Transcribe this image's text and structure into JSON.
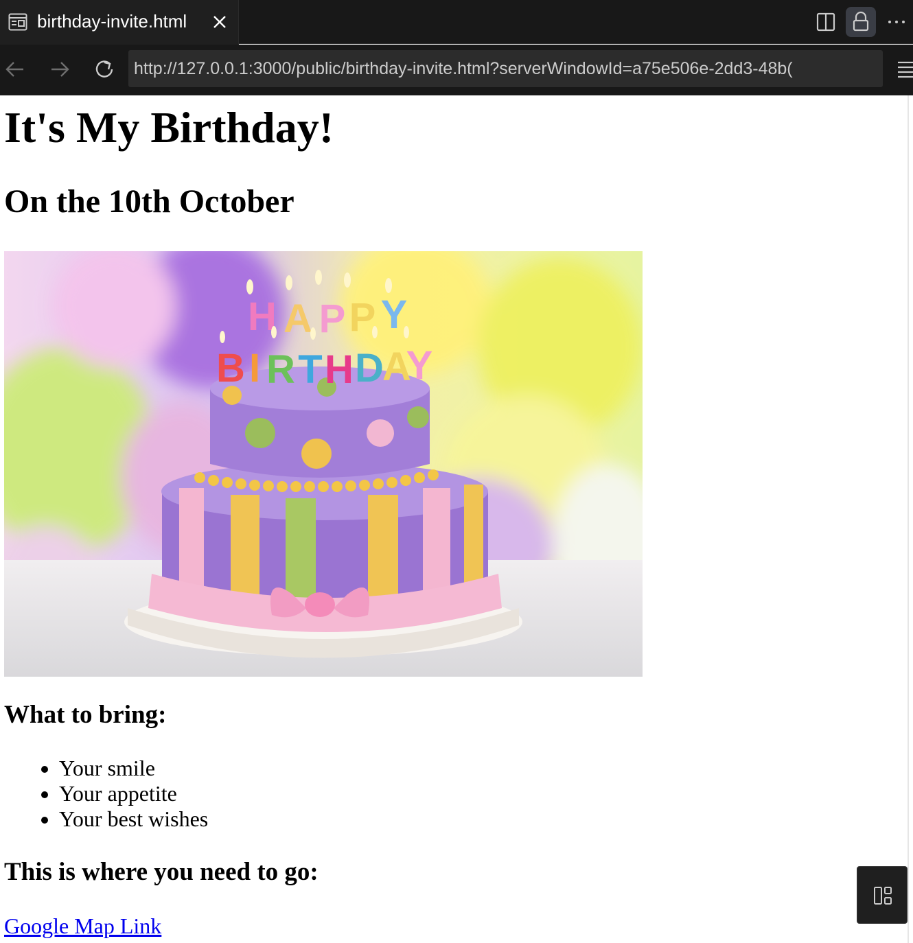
{
  "tab": {
    "title": "birthday-invite.html",
    "icon": "preview-icon",
    "close_icon": "close-icon"
  },
  "toolbar_right": {
    "icons": [
      "split-editor-icon",
      "lock-icon",
      "more-icon"
    ]
  },
  "navigation": {
    "icons": [
      "back-arrow-icon",
      "forward-arrow-icon",
      "reload-icon",
      "menu-icon"
    ],
    "url": "http://127.0.0.1:3000/public/birthday-invite.html?serverWindowId=a75e506e-2dd3-48b("
  },
  "content": {
    "heading": "It's My Birthday!",
    "date_heading": "On the 10th October",
    "image_alt": "Birthday cake",
    "cake_candle_text": [
      "HAPPY",
      "BIRTHDAY"
    ],
    "bring_heading": "What to bring:",
    "bring_items": [
      "Your smile",
      "Your appetite",
      "Your best wishes"
    ],
    "directions_heading": "This is where you need to go:",
    "map_link_label": "Google Map Link"
  },
  "colors": {
    "chrome_bg": "#181818",
    "tab_bg": "#1f1f1f",
    "url_bg": "#2c2c2c",
    "link": "#0000ee"
  },
  "floating_button_icon": "layout-panel-icon"
}
